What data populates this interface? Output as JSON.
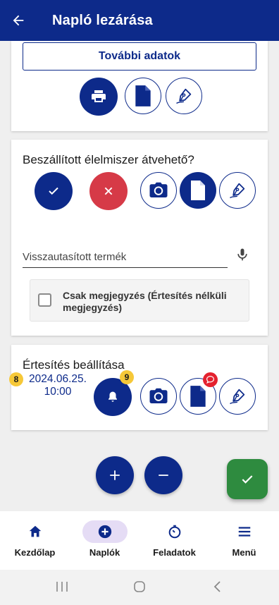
{
  "header": {
    "title": "Napló lezárása",
    "back_icon": "arrow-left-icon"
  },
  "card_top": {
    "more_button": "További adatok",
    "buttons": [
      "printer-icon",
      "document-icon",
      "signature-pen-icon"
    ]
  },
  "card_delivery": {
    "question": "Beszállított élelmiszer átvehető?",
    "input_placeholder": "Visszautasított termék",
    "note_checkbox_label": "Csak megjegyzés (Értesítés nélküli megjegyzés)",
    "note_checked": false
  },
  "card_notify": {
    "title": "Értesítés beállítása",
    "date": "2024.06.25.",
    "time": "10:00",
    "badge_date": "8",
    "badge_bell": "9"
  },
  "bottom_nav": {
    "items": [
      {
        "label": "Kezdőlap",
        "icon": "home-icon",
        "active": false
      },
      {
        "label": "Naplók",
        "icon": "plus-circle-icon",
        "active": true
      },
      {
        "label": "Feladatok",
        "icon": "timer-icon",
        "active": false
      },
      {
        "label": "Menü",
        "icon": "menu-icon",
        "active": false
      }
    ]
  },
  "colors": {
    "primary": "#0d2a8a",
    "reject": "#d63a47",
    "confirm": "#2e8b3f",
    "badge": "#f6c838",
    "nav_active": "#e5dcf5"
  }
}
